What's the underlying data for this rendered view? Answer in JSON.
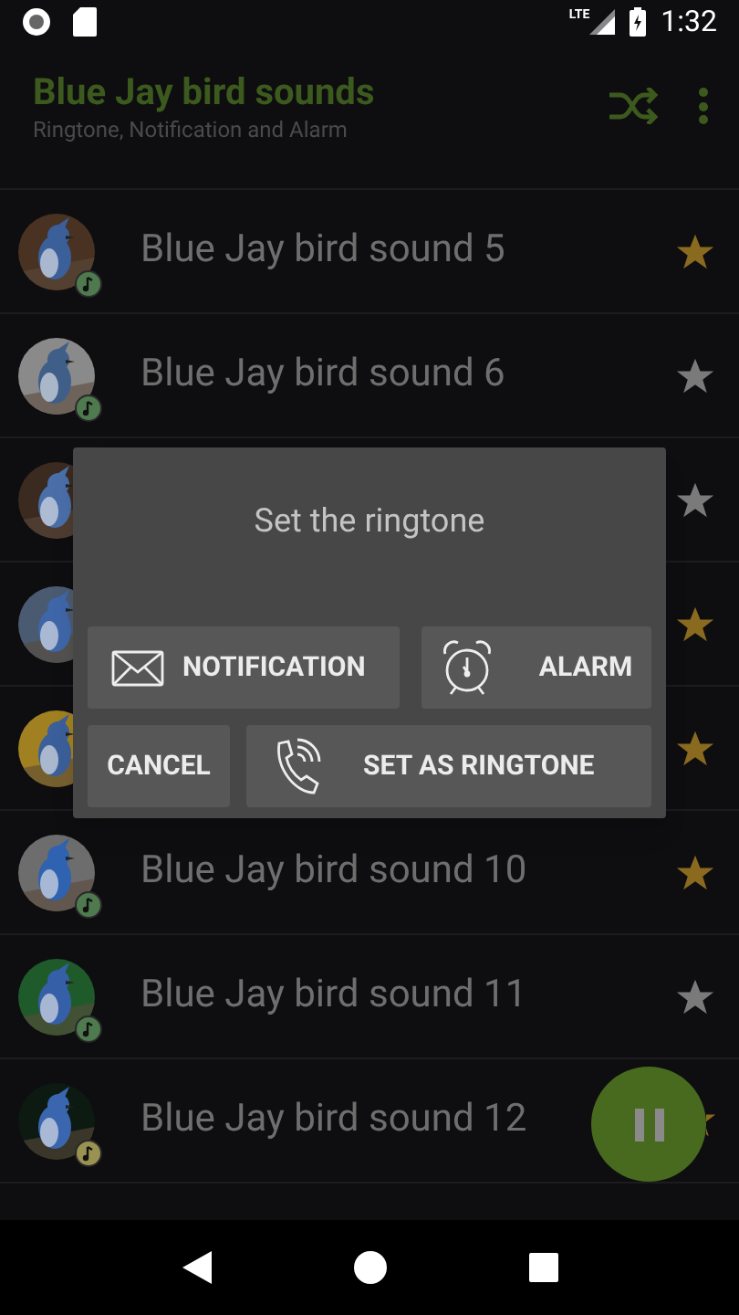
{
  "status_bar": {
    "time": "1:32",
    "network": "LTE"
  },
  "app_bar": {
    "title": "Blue Jay bird sounds",
    "subtitle": "Ringtone, Notification and Alarm"
  },
  "list": [
    {
      "title": "Blue Jay bird sound 5",
      "favorite": true,
      "playing": false
    },
    {
      "title": "Blue Jay bird sound 6",
      "favorite": false,
      "playing": false
    },
    {
      "favorite": false
    },
    {
      "favorite": true
    },
    {
      "favorite": true
    },
    {
      "title": "Blue Jay bird sound 10",
      "favorite": true,
      "playing": false
    },
    {
      "title": "Blue Jay bird sound 11",
      "favorite": false,
      "playing": false
    },
    {
      "title": "Blue Jay bird sound 12",
      "favorite": true,
      "playing": true
    }
  ],
  "dialog": {
    "title": "Set the ringtone",
    "buttons": [
      {
        "label": "NOTIFICATION",
        "kind": "notification"
      },
      {
        "label": "ALARM",
        "kind": "alarm"
      },
      {
        "label": "CANCEL",
        "kind": "cancel"
      },
      {
        "label": "SET AS RINGTONE",
        "kind": "ringtone"
      }
    ]
  },
  "fab": {
    "kind": "pause"
  }
}
